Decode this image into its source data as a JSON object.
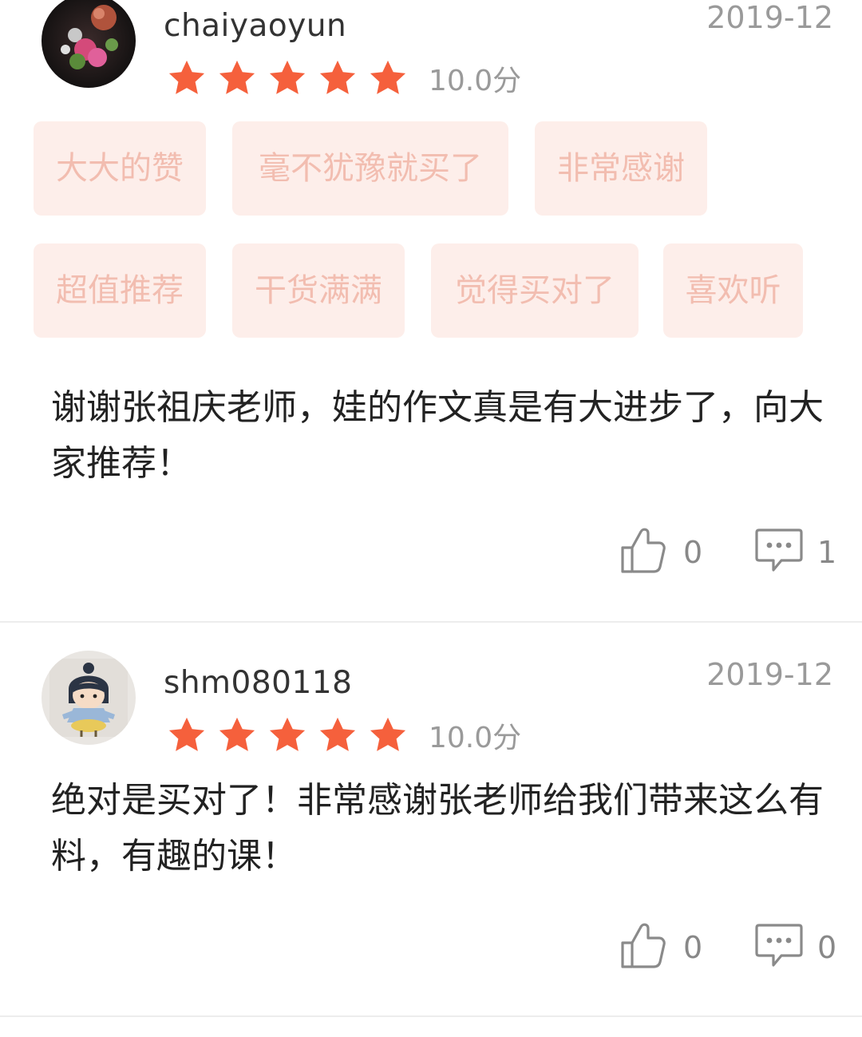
{
  "reviews": [
    {
      "username": "chaiyaoyun",
      "date": "2019-12",
      "rating": 5,
      "score": "10.0分",
      "tags": [
        "大大的赞",
        "毫不犹豫就买了",
        "非常感谢",
        "超值推荐",
        "干货满满",
        "觉得买对了",
        "喜欢听"
      ],
      "content": "谢谢张祖庆老师，娃的作文真是有大进步了，向大家推荐！",
      "likes": "0",
      "comments": "1"
    },
    {
      "username": "shm080118",
      "date": "2019-12",
      "rating": 5,
      "score": "10.0分",
      "tags": [],
      "content": "绝对是买对了！非常感谢张老师给我们带来这么有料，有趣的课！",
      "likes": "0",
      "comments": "0"
    }
  ],
  "icons": {
    "star": "star-icon",
    "like": "thumbs-up-icon",
    "comment": "comment-bubble-icon"
  },
  "colors": {
    "star": "#f5603c",
    "tag_bg": "#fdeeea",
    "tag_text": "#f2bdb0",
    "muted": "#9a9a9a"
  }
}
